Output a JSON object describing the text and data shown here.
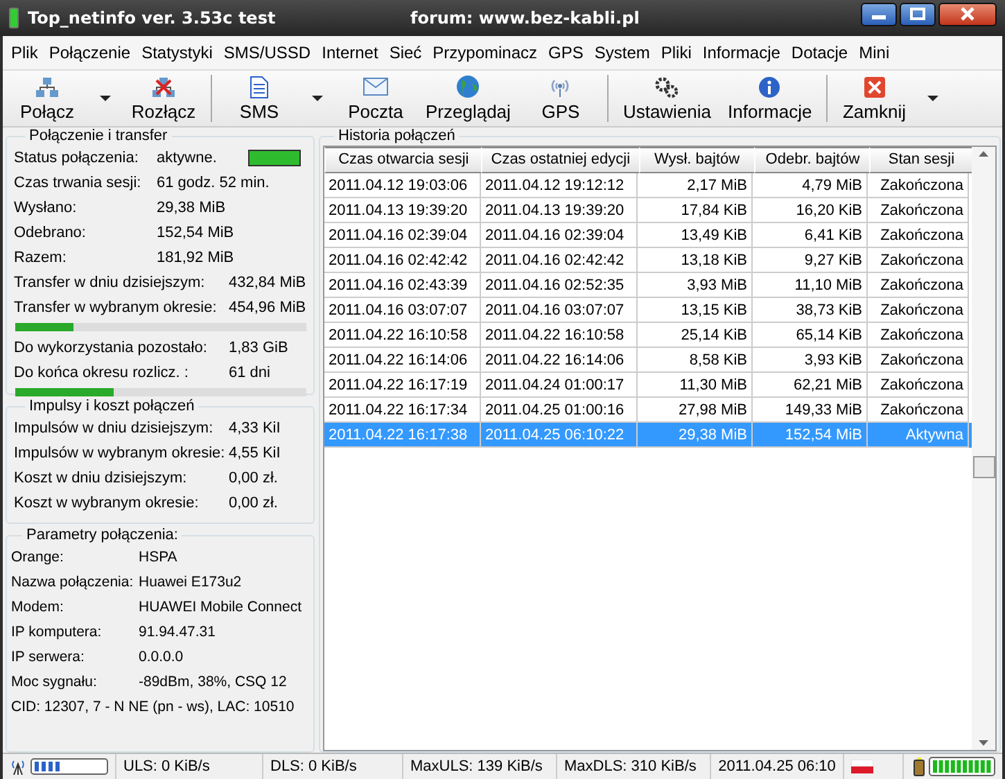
{
  "window": {
    "title": "Top_netinfo ver. 3.53c test",
    "subtitle": "forum: www.bez-kabli.pl"
  },
  "menu": [
    "Plik",
    "Połączenie",
    "Statystyki",
    "SMS/USSD",
    "Internet",
    "Sieć",
    "Przypominacz",
    "GPS",
    "System",
    "Pliki",
    "Informacje",
    "Dotacje",
    "Mini"
  ],
  "toolbar": [
    {
      "kind": "button",
      "label": "Połącz"
    },
    {
      "kind": "dropdown"
    },
    {
      "kind": "button",
      "label": "Rozłącz"
    },
    {
      "kind": "separator"
    },
    {
      "kind": "button",
      "label": "SMS"
    },
    {
      "kind": "dropdown"
    },
    {
      "kind": "button",
      "label": "Poczta"
    },
    {
      "kind": "button",
      "label": "Przeglądaj"
    },
    {
      "kind": "button",
      "label": "GPS"
    },
    {
      "kind": "separator"
    },
    {
      "kind": "button",
      "label": "Ustawienia"
    },
    {
      "kind": "button",
      "label": "Informacje"
    },
    {
      "kind": "separator"
    },
    {
      "kind": "button",
      "label": "Zamknij"
    },
    {
      "kind": "dropdown"
    }
  ],
  "connection": {
    "title": "Połączenie i transfer",
    "active": true,
    "rows": [
      {
        "kind": "status",
        "label": "Status połączenia:",
        "value": "aktywne."
      },
      {
        "kind": "pair",
        "label": "Czas trwania sesji:",
        "value": "61 godz. 52 min."
      },
      {
        "kind": "pair",
        "label": "Wysłano:",
        "value": "29,38 MiB"
      },
      {
        "kind": "pair",
        "label": "Odebrano:",
        "value": "152,54 MiB"
      },
      {
        "kind": "pair",
        "label": "Razem:",
        "value": "181,92 MiB"
      },
      {
        "kind": "wide",
        "label": "Transfer w dniu dzisiejszym:",
        "value": "432,84 MiB"
      },
      {
        "kind": "wide",
        "label": "Transfer w wybranym okresie:",
        "value": "454,96 MiB"
      },
      {
        "kind": "bar",
        "level": 0.2
      },
      {
        "kind": "wide",
        "label": "Do wykorzystania pozostało:",
        "value": "1,83 GiB"
      },
      {
        "kind": "wide",
        "label": "Do końca okresu rozlicz. :",
        "value": "61 dni"
      },
      {
        "kind": "bar",
        "level": 0.34
      }
    ]
  },
  "impulses": {
    "title": "Impulsy i koszt połączeń",
    "rows": [
      {
        "label": "Impulsów w dniu dzisiejszym:",
        "value": "4,33 KiI"
      },
      {
        "label": "Impulsów w wybranym okresie:",
        "value": "4,55 KiI"
      },
      {
        "label": "Koszt w dniu dzisiejszym:",
        "value": "0,00 zł."
      },
      {
        "label": "Koszt w wybranym okresie:",
        "value": "0,00 zł."
      }
    ]
  },
  "parameters": {
    "title": "Parametry połączenia:",
    "rows": [
      {
        "label": "Orange:",
        "value": "HSPA"
      },
      {
        "label": "Nazwa połączenia:",
        "value": "Huawei E173u2"
      },
      {
        "label": "Modem:",
        "value": "HUAWEI Mobile Connect"
      },
      {
        "label": "IP komputera:",
        "value": "91.94.47.31"
      },
      {
        "label": "IP serwera:",
        "value": "0.0.0.0"
      },
      {
        "label": "Moc sygnału:",
        "value": "-89dBm, 38%, CSQ 12"
      }
    ],
    "footer": "CID: 12307, 7 - N NE (pn - ws), LAC: 10510"
  },
  "history": {
    "title": "Historia połączeń",
    "columns": [
      "Czas otwarcia sesji",
      "Czas ostatniej edycji",
      "Wysł. bajtów",
      "Odebr. bajtów",
      "Stan sesji"
    ],
    "rows": [
      {
        "cells": [
          "2011.04.12 19:03:06",
          "2011.04.12 19:12:12",
          "2,17 MiB",
          "4,79 MiB",
          "Zakończona"
        ],
        "selected": false
      },
      {
        "cells": [
          "2011.04.13 19:39:20",
          "2011.04.13 19:39:20",
          "17,84 KiB",
          "16,20 KiB",
          "Zakończona"
        ],
        "selected": false
      },
      {
        "cells": [
          "2011.04.16 02:39:04",
          "2011.04.16 02:39:04",
          "13,49 KiB",
          "6,41 KiB",
          "Zakończona"
        ],
        "selected": false
      },
      {
        "cells": [
          "2011.04.16 02:42:42",
          "2011.04.16 02:42:42",
          "13,18 KiB",
          "9,27 KiB",
          "Zakończona"
        ],
        "selected": false
      },
      {
        "cells": [
          "2011.04.16 02:43:39",
          "2011.04.16 02:52:35",
          "3,93 MiB",
          "11,10 MiB",
          "Zakończona"
        ],
        "selected": false
      },
      {
        "cells": [
          "2011.04.16 03:07:07",
          "2011.04.16 03:07:07",
          "13,15 KiB",
          "38,73 KiB",
          "Zakończona"
        ],
        "selected": false
      },
      {
        "cells": [
          "2011.04.22 16:10:58",
          "2011.04.22 16:10:58",
          "25,14 KiB",
          "65,14 KiB",
          "Zakończona"
        ],
        "selected": false
      },
      {
        "cells": [
          "2011.04.22 16:14:06",
          "2011.04.22 16:14:06",
          "8,58 KiB",
          "3,93 KiB",
          "Zakończona"
        ],
        "selected": false
      },
      {
        "cells": [
          "2011.04.22 16:17:19",
          "2011.04.24 01:00:17",
          "11,30 MiB",
          "62,21 MiB",
          "Zakończona"
        ],
        "selected": false
      },
      {
        "cells": [
          "2011.04.22 16:17:34",
          "2011.04.25 01:00:16",
          "27,98 MiB",
          "149,33 MiB",
          "Zakończona"
        ],
        "selected": false
      },
      {
        "cells": [
          "2011.04.22 16:17:38",
          "2011.04.25 06:10:22",
          "29,38 MiB",
          "152,54 MiB",
          "Aktywna"
        ],
        "selected": true
      }
    ]
  },
  "status_bar": [
    "ULS: 0 KiB/s",
    "DLS: 0 KiB/s",
    "MaxULS: 139 KiB/s",
    "MaxDLS: 310 KiB/s",
    "2011.04.25  06:10"
  ]
}
